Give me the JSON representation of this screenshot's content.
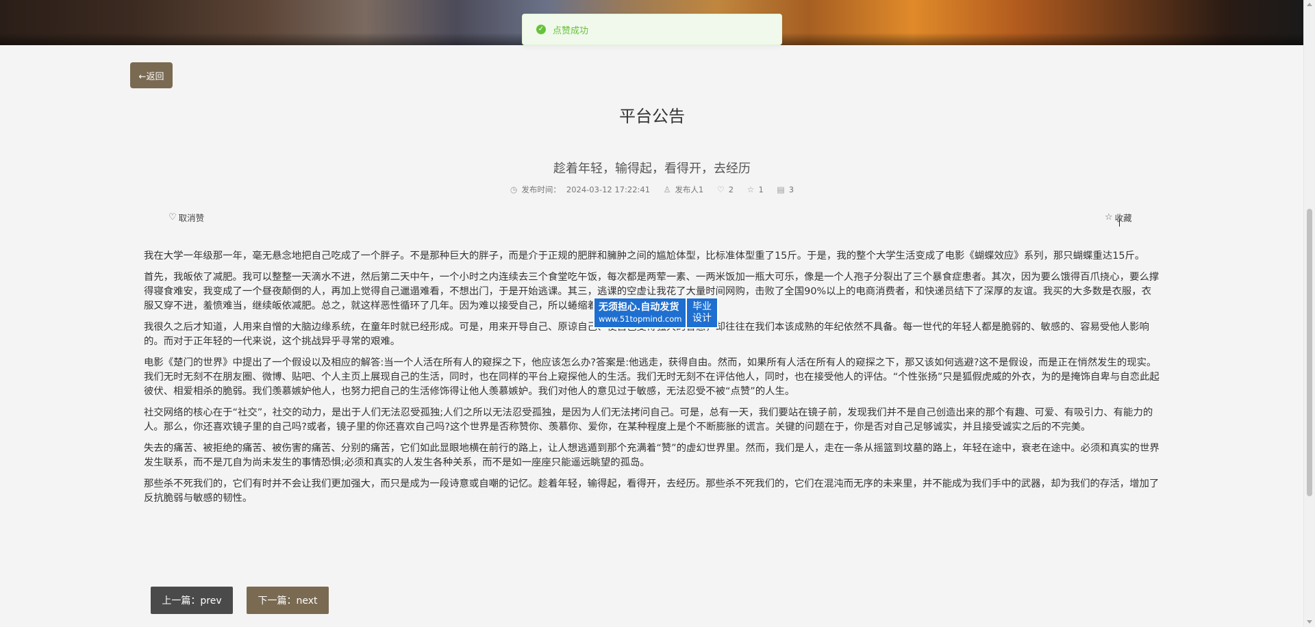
{
  "toast": {
    "icon": "check-circle-icon",
    "message": "点赞成功",
    "color": "#67c23a"
  },
  "back_button": {
    "label": "←返回"
  },
  "page_title": "平台公告",
  "article": {
    "title": "趁着年轻，输得起，看得开，去经历",
    "meta": {
      "publish_label": "发布时间：",
      "publish_time": "2024-03-12 17:22:41",
      "author": "发布人1",
      "likes": "2",
      "favorites": "1",
      "comments": "3"
    },
    "unlike_label": "取消赞",
    "favorite_label": "收藏",
    "paragraphs": [
      "我在大学一年级那一年，毫无悬念地把自己吃成了一个胖子。不是那种巨大的胖子，而是介于正规的肥胖和臃肿之间的尴尬体型，比标准体型重了15斤。于是，我的整个大学生活变成了电影《蝴蝶效应》系列，那只蝴蝶重达15斤。",
      "首先，我皈依了减肥。我可以整整一天滴水不进，然后第二天中午，一个小时之内连续去三个食堂吃午饭，每次都是两荤一素、一两米饭加一瓶大可乐，像是一个人孢子分裂出了三个暴食症患者。其次，因为要么饿得百爪挠心，要么撑得寝食难安，我变成了一个昼夜颠倒的人，再加上觉得自己邋遢难看，不想出门，于是开始逃课。其三，逃课的空虚让我花了大量时间网购，击败了全国90%以上的电商消费者，和快递员结下了深厚的友谊。我买的大多数是衣服，衣服又穿不进，羞愤难当，继续皈依减肥。总之，就这样恶性循环了几年。因为难以接受自己，所以蜷缩着，拒绝他人。",
      "我很久之后才知道，人用来自憎的大脑边缘系统，在童年时就已经形成。可是，用来开导自己、原谅自己、使自己变得强大的智慧，却往往在我们本该成熟的年纪依然不具备。每一世代的年轻人都是脆弱的、敏感的、容易受他人影响的。而对于正年轻的一代来说，这个挑战异乎寻常的艰难。",
      "电影《楚门的世界》中提出了一个假设以及相应的解答:当一个人活在所有人的窥探之下，他应该怎么办?答案是:他逃走，获得自由。然而，如果所有人活在所有人的窥探之下，那又该如何逃避?这不是假设，而是正在悄然发生的现实。我们无时无刻不在朋友圈、微博、贴吧、个人主页上展现自己的生活，同时，也在同样的平台上窥探他人的生活。我们无时无刻不在评估他人，同时，也在接受他人的评估。“个性张扬”只是狐假虎威的外衣，为的是掩饰自卑与自恋此起彼伏、相爱相杀的脆弱。我们羡慕嫉妒他人，也努力把自己的生活修饰得让他人羡慕嫉妒。我们对他人的意见过于敏感，无法忍受不被“点赞”的人生。",
      "社交网络的核心在于“社交”，社交的动力，是出于人们无法忍受孤独;人们之所以无法忍受孤独，是因为人们无法拷问自己。可是，总有一天，我们要站在镜子前，发现我们并不是自己创造出来的那个有趣、可爱、有吸引力、有能力的人。那么，你还喜欢镜子里的自己吗?或者，镜子里的你还喜欢自己吗?这个世界是否称赞你、羡慕你、爱你，在某种程度上是个不断膨胀的谎言。关键的问题在于，你是否对自己足够诚实，并且接受诚实之后的不完美。",
      "失去的痛苦、被拒绝的痛苦、被伤害的痛苦、分别的痛苦，它们如此显眼地横在前行的路上，让人想逃遁到那个充满着“赞”的虚幻世界里。然而，我们是人，走在一条从摇篮到坟墓的路上，年轻在途中，衰老在途中。必须和真实的世界发生联系，而不是兀自为尚未发生的事情恐惧;必须和真实的人发生各种关系，而不是如一座座只能遥远眺望的孤岛。",
      "那些杀不死我们的，它们有时并不会让我们更加强大，而只是成为一段诗意或自嘲的记忆。趁着年轻，输得起，看得开，去经历。那些杀不死我们的，它们在混沌而无序的未来里，并不能成为我们手中的武器，却为我们的存活，增加了反抗脆弱与敏感的韧性。"
    ]
  },
  "watermark": {
    "line1": "无须担心.自动发货",
    "line2": "www.51topmind.com",
    "right_top": "毕业",
    "right_bottom": "设计"
  },
  "nav": {
    "prev_label": "上一篇：prev",
    "next_label": "下一篇：next"
  },
  "icons": {
    "time": "clock-icon",
    "author": "user-icon",
    "like": "thumb-up-icon",
    "favorite": "star-icon",
    "comment": "comment-icon",
    "unlike": "heart-icon"
  }
}
